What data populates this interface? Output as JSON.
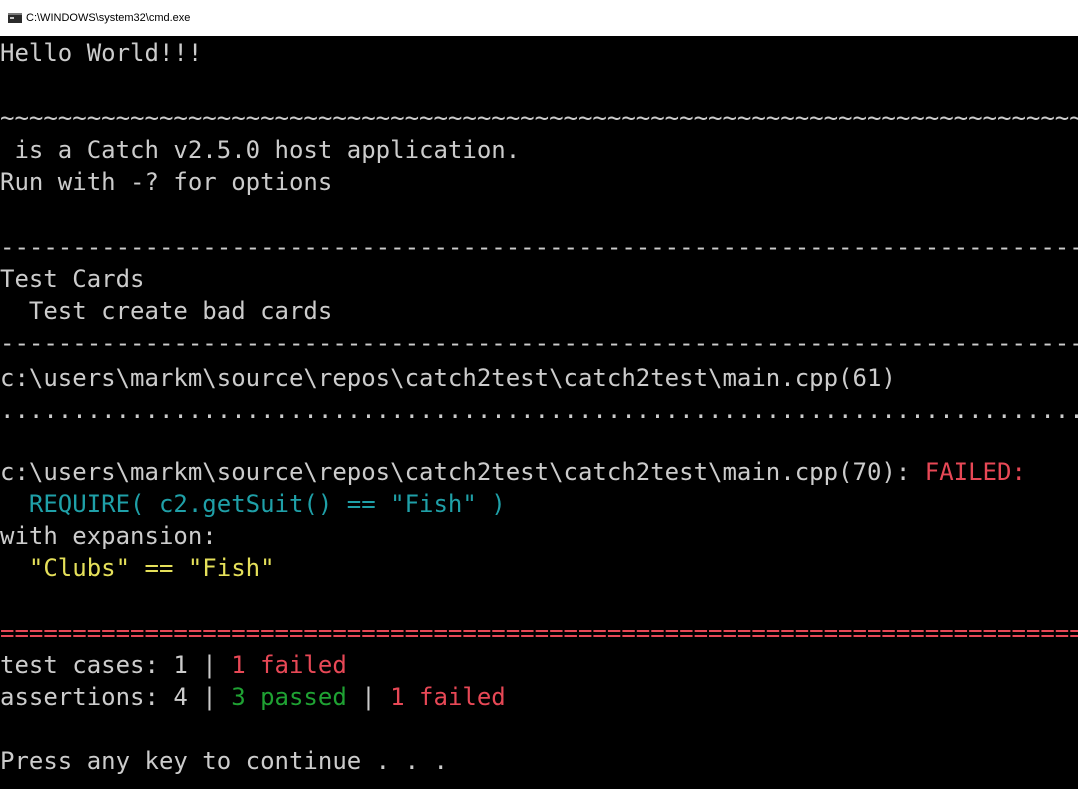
{
  "window": {
    "title": "C:\\WINDOWS\\system32\\cmd.exe"
  },
  "console": {
    "hello": "Hello World!!!",
    "tilde_rule": "~~~~~~~~~~~~~~~~~~~~~~~~~~~~~~~~~~~~~~~~~~~~~~~~~~~~~~~~~~~~~~~~~~~~~~~~~~~~~~~~~~~~~~~~~~~~~~~~~~~~~~~~~~~~~~~~~~~~~~~~~~~~~",
    "host_app": " is a Catch v2.5.0 host application.",
    "run_with": "Run with -? for options",
    "dash_rule_1": "-------------------------------------------------------------------------------",
    "test_case": "Test Cards",
    "section": "  Test create bad cards",
    "dash_rule_2": "-------------------------------------------------------------------------------",
    "location_1": "c:\\users\\markm\\source\\repos\\catch2test\\catch2test\\main.cpp(61)",
    "dot_rule": "...............................................................................",
    "location_2": "c:\\users\\markm\\source\\repos\\catch2test\\catch2test\\main.cpp(70): ",
    "failed_label": "FAILED:",
    "require_expr": "  REQUIRE( c2.getSuit() == \"Fish\" )",
    "with_expansion": "with expansion:",
    "expansion_value": "  \"Clubs\" == \"Fish\"",
    "eq_rule": "===============================================================================",
    "summary_cases_prefix": "test cases: 1 | ",
    "summary_cases_failed": "1 failed",
    "summary_assert_prefix": "assertions: 4 | ",
    "summary_assert_passed": "3 passed",
    "summary_assert_sep": " | ",
    "summary_assert_failed": "1 failed",
    "press_any_key": "Press any key to continue . . ."
  },
  "colors": {
    "background": "#000000",
    "default_text": "#cccccc",
    "failed": "#e74856",
    "expression": "#1fa0a8",
    "expansion": "#e5e05a",
    "passed": "#1fa233"
  }
}
